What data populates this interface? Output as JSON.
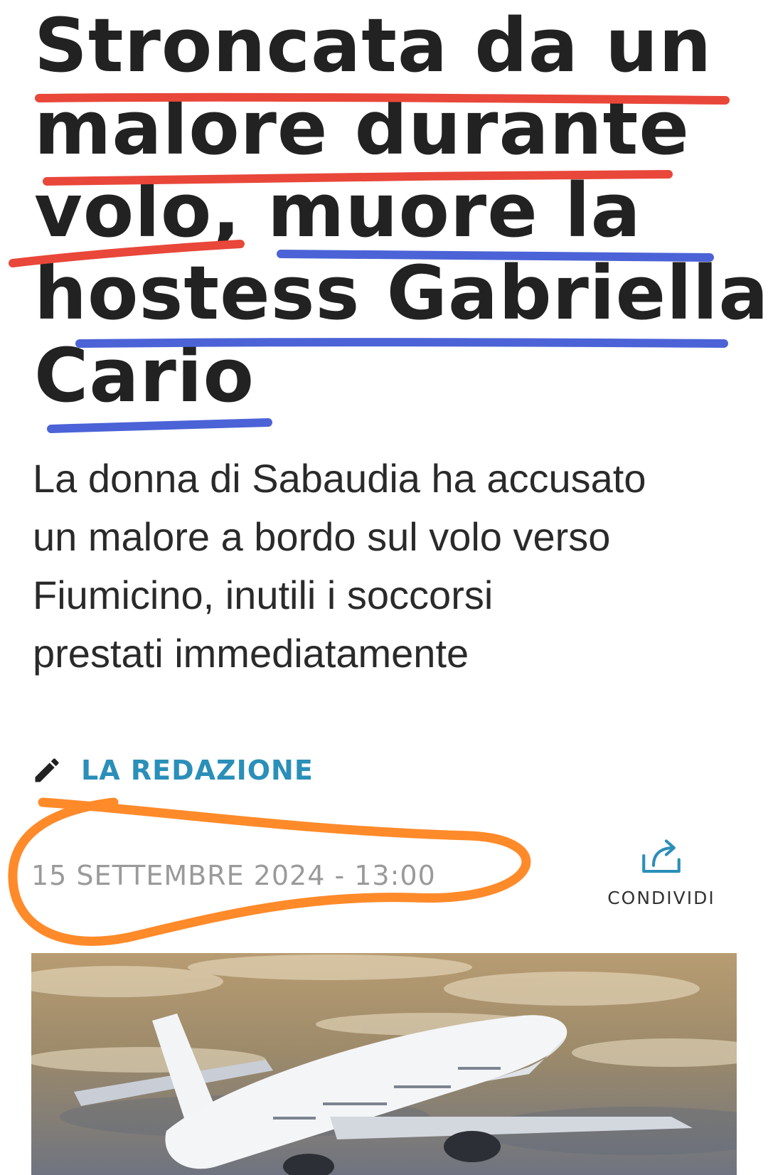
{
  "article": {
    "headline_lines": [
      "Stroncata da un",
      "malore durante",
      "volo, muore la",
      "hostess Gabriella",
      "Cario"
    ],
    "subtitle_lines": [
      "La donna di Sabaudia ha accusato",
      "un malore a bordo sul volo verso",
      "Fiumicino, inutili i soccorsi",
      "prestati immediatamente"
    ],
    "author": "LA REDAZIONE",
    "author_icon": "pencil-icon",
    "date": "15 SETTEMBRE 2024 - 13:00",
    "share_label": "CONDIVIDI",
    "share_icon": "share-icon",
    "image": "airplane-photo"
  },
  "colors": {
    "headline": "#222222",
    "author_link": "#2a8fb9",
    "date": "#9a9a9a",
    "red_underline": "#e8473a",
    "blue_underline": "#4b63d6",
    "orange_circle": "#ff8a2a"
  }
}
